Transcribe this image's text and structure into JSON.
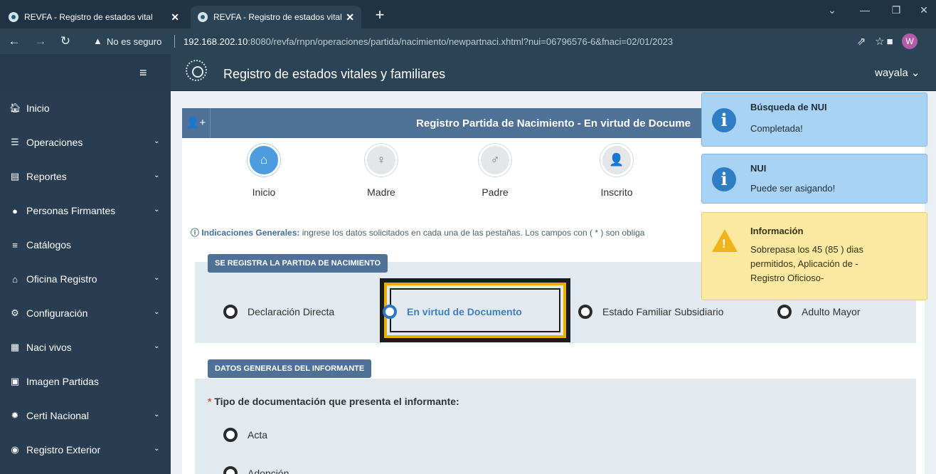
{
  "browser": {
    "tabs": [
      {
        "title": "REVFA - Registro de estados vital",
        "close": "✕"
      },
      {
        "title": "REVFA - Registro de estados vital",
        "close": "✕"
      }
    ],
    "new_tab": "+",
    "security_label": "No es seguro",
    "url_host": "192.168.202.10",
    "url_rest": ":8080/revfa/rnpn/operaciones/partida/nacimiento/newpartnaci.xhtml?nui=06796576-6&fnaci=02/01/2023",
    "profile_initial": "W"
  },
  "header": {
    "app_title": "Registro de estados vitales y familiares",
    "user": "wayala ⌄"
  },
  "sidebar": {
    "items": [
      {
        "label": "Inicio",
        "icon": "home-icon",
        "glyph": "🏠︎"
      },
      {
        "label": "Operaciones",
        "icon": "tasks-icon",
        "glyph": "☰"
      },
      {
        "label": "Reportes",
        "icon": "file-icon",
        "glyph": "▤"
      },
      {
        "label": "Personas Firmantes",
        "icon": "user-icon",
        "glyph": "●"
      },
      {
        "label": "Catálogos",
        "icon": "list-icon",
        "glyph": "≡"
      },
      {
        "label": "Oficina Registro",
        "icon": "home-icon",
        "glyph": "⌂"
      },
      {
        "label": "Configuración",
        "icon": "cogs-icon",
        "glyph": "⚙"
      },
      {
        "label": "Naci vivos",
        "icon": "building-icon",
        "glyph": "▦"
      },
      {
        "label": "Imagen Partidas",
        "icon": "image-icon",
        "glyph": "▣"
      },
      {
        "label": "Certi Nacional",
        "icon": "certificate-icon",
        "glyph": "✹"
      },
      {
        "label": "Registro Exterior",
        "icon": "globe-icon",
        "glyph": "◉"
      }
    ]
  },
  "panel": {
    "title": "Registro Partida de Nacimiento - En virtud de Docume",
    "steps": [
      {
        "label": "Inicio",
        "icon": "home-icon",
        "glyph": "⌂",
        "active": true
      },
      {
        "label": "Madre",
        "icon": "female-icon",
        "glyph": "♀"
      },
      {
        "label": "Padre",
        "icon": "male-icon",
        "glyph": "♂"
      },
      {
        "label": "Inscrito",
        "icon": "user-plus-icon",
        "glyph": "👤"
      }
    ],
    "indications_bold": "Indicaciones Generales:",
    "indications_text": " ingrese los datos solicitados en cada una de las pestañas. Los campos con ( * ) son obliga",
    "section1": {
      "tag": "SE REGISTRA LA PARTIDA DE NACIMIENTO",
      "options": [
        "Declaración Directa",
        "En virtud de Documento",
        "Estado Familiar Subsidiario",
        "Adulto Mayor"
      ],
      "selected": "En virtud de Documento"
    },
    "section2": {
      "tag": "DATOS GENERALES DEL INFORMANTE",
      "question_required": "*",
      "question": "Tipo de documentación que presenta el informante:",
      "options": [
        "Acta",
        "Adopción"
      ]
    }
  },
  "toasts": [
    {
      "type": "info",
      "title": "Búsqueda de NUI",
      "message": "Completada!"
    },
    {
      "type": "info",
      "title": "NUI",
      "message": "Puede ser asigando!"
    },
    {
      "type": "warn",
      "title": "Información",
      "message": "Sobrepasa los 45 (85 ) dias permitidos, Aplicación de -Registro Oficioso-"
    }
  ]
}
